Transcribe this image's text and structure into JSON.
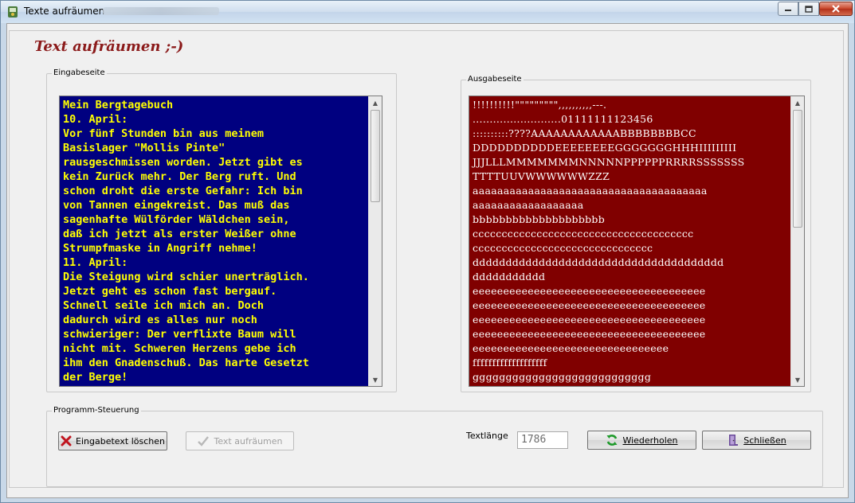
{
  "window": {
    "title": "Texte aufräumen",
    "controls": {
      "minimize": "minimize",
      "maximize": "maximize",
      "close": "close"
    }
  },
  "heading": "Text aufräumen ;-)",
  "input_group": {
    "label": "Eingabeseite",
    "text": "Mein Bergtagebuch\n10. April:\nVor fünf Stunden bin aus meinem\nBasislager \"Mollis Pinte\"\nrausgeschmissen worden. Jetzt gibt es\nkein Zurück mehr. Der Berg ruft. Und\nschon droht die erste Gefahr: Ich bin\nvon Tannen eingekreist. Das muß das\nsagenhafte Wülförder Wäldchen sein,\ndaß ich jetzt als erster Weißer ohne\nStrumpfmaske in Angriff nehme!\n11. April:\nDie Steigung wird schier unerträglich.\nJetzt geht es schon fast bergauf.\nSchnell seile ich mich an. Doch\ndadurch wird es alles nur noch\nschwieriger: Der verflixte Baum will\nnicht mit. Schweren Herzens gebe ich\nihm den Gnadenschuß. Das harte Gesetzt\nder Berge!",
    "colors": {
      "background": "#000080",
      "text": "#ffff00"
    }
  },
  "output_group": {
    "label": "Ausgabeseite",
    "text": "!!!!!!!!!!\"\"\"\"\"\"\"\"\",,,,,,,,,,---.\n..........................01111111123456\n::::::::::????AAAAAAAAAAAABBBBBBBBCC\nDDDDDDDDDDEEEEEEEEGGGGGGGHHHIIIIIIIII\nJJJLLLMMMMMMMNNNNNPPPPPPRRRRSSSSSSS\nTTTTUUVWWWWWWZZZ\naaaaaaaaaaaaaaaaaaaaaaaaaaaaaaaaaaaaaa\naaaaaaaaaaaaaaaaaa\nbbbbbbbbbbbbbbbbbbbb\ncccccccccccccccccccccccccccccccccccccc\nccccccccccccccccccccccccccccccc\ndddddddddddddddddddddddddddddddddddddd\nddddddddddd\neeeeeeeeeeeeeeeeeeeeeeeeeeeeeeeeeeeeee\neeeeeeeeeeeeeeeeeeeeeeeeeeeeeeeeeeeeee\neeeeeeeeeeeeeeeeeeeeeeeeeeeeeeeeeeeeee\neeeeeeeeeeeeeeeeeeeeeeeeeeeeeeeeeeeeee\neeeeeeeeeeeeeeeeeeeeeeeeeeeeeeee\nfffffffffffffffffff\nggggggggggggggggggggggggggg",
    "colors": {
      "background": "#800000",
      "text": "#ffffff"
    }
  },
  "control_group": {
    "label": "Programm-Steuerung",
    "clear_button": "Eingabetext löschen",
    "clean_button": "Text aufräumen",
    "textlength_label": "Textlänge",
    "textlength_value": "1786",
    "repeat_button": "Wiederholen",
    "close_button": "Schließen"
  },
  "icons": {
    "clear": "red-x-icon",
    "clean": "checkmark-icon",
    "repeat": "green-refresh-icon",
    "close": "door-exit-icon"
  }
}
